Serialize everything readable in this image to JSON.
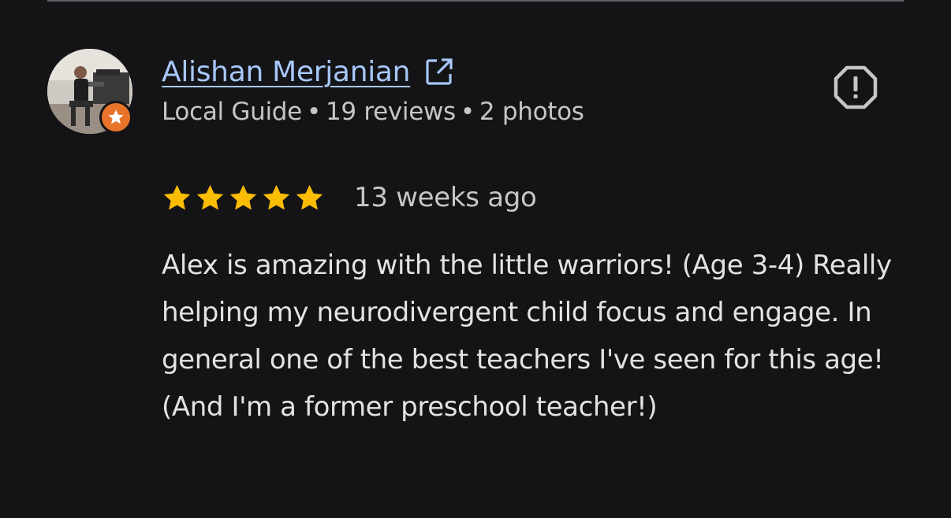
{
  "reviewer": {
    "name": "Alishan Merjanian",
    "role": "Local Guide",
    "separator": "•",
    "reviews_count": "19 reviews",
    "photos_count": "2 photos"
  },
  "review": {
    "rating": 5,
    "time": "13 weeks ago",
    "text": "Alex is amazing with the little warriors! (Age 3-4) Really helping my neurodivergent child focus and engage. In general one of the best teachers I've seen for this age! (And I'm a former preschool teacher!)"
  },
  "icons": {
    "avatar": "avatar-photo",
    "badge": "local-guide-star-icon",
    "external_link": "external-link-icon",
    "report": "report-octagon-icon",
    "star": "star-icon"
  },
  "colors": {
    "background": "#141416",
    "link": "#a8c7fa",
    "meta_text": "#c4c7c5",
    "body_text": "#e3e3e3",
    "star": "#fbbc04",
    "badge": "#e8742c",
    "report_icon": "#c4c7c5"
  }
}
